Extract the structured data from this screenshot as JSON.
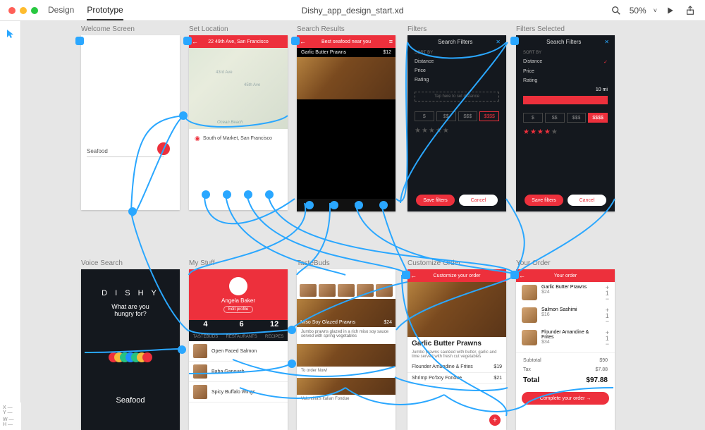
{
  "header": {
    "design_tab": "Design",
    "prototype_tab": "Prototype",
    "filename": "Dishy_app_design_start.xd",
    "zoom": "50%"
  },
  "footer": {
    "x_label": "X",
    "y_label": "Y",
    "w_label": "W",
    "h_label": "H"
  },
  "artboards": {
    "welcome": {
      "label": "Welcome Screen",
      "search_text": "Seafood"
    },
    "set_location": {
      "label": "Set Location",
      "address": "22 49th Ave, San Francisco",
      "marker_text": "South of Market, San Francisco",
      "ocean": "Ocean Beach",
      "ave_a": "43rd Ave",
      "ave_b": "45th Ave"
    },
    "search_results": {
      "label": "Search Results",
      "header_text": "Best seafood near you",
      "item_name": "Garlic Butter Prawns",
      "item_price": "$12"
    },
    "filters": {
      "label": "Filters",
      "title": "Search Filters",
      "sort_by": "SORT BY",
      "distance": "Distance",
      "price": "Price",
      "rating": "Rating",
      "tap_hint": "Tap here to set distance",
      "p1": "$",
      "p2": "$$",
      "p3": "$$$",
      "p4": "$$$$",
      "save": "Save filters",
      "cancel": "Cancel"
    },
    "filters_selected": {
      "label": "Filters Selected",
      "title": "Search Filters",
      "distance_val": "10 mi",
      "save": "Save filters",
      "cancel": "Cancel"
    },
    "voice_search": {
      "label": "Voice Search",
      "brand": "D I S H Y",
      "prompt_a": "What are you",
      "prompt_b": "hungry for?",
      "result": "Seafood"
    },
    "my_stuff": {
      "label": "My Stuff",
      "name": "Angela Baker",
      "edit": "Edit profile",
      "n1": "4",
      "l1": "TASTEBUDS",
      "n2": "6",
      "l2": "RESTAURANTS",
      "n3": "12",
      "l3": "RECIPES",
      "r1": "Open Faced Salmon",
      "r2": "Baba Ganoush",
      "r3": "Spicy Buffalo Wings"
    },
    "tastebuds": {
      "label": "TasteBuds",
      "dish_name": "Miso Soy Glazed Prawns",
      "dish_price": "$24",
      "caption_a": "Jumbo prawns glazed in a rich miso soy sauce served with spring vegetables",
      "caption_b": "To order Now!",
      "caption_c": "Valentina's Italian Fondue"
    },
    "customize": {
      "label": "Customize Order",
      "header_text": "Customize your order",
      "dish_name": "Garlic Butter Prawns",
      "desc": "Jumbo prawns sautéed with butter, garlic and lime served with fresh cut vegetables",
      "opt1": "Flounder Amandine & Frites",
      "opt1_price": "$19",
      "opt2": "Shrimp Po'boy Fondue",
      "opt2_price": "$21"
    },
    "your_order": {
      "label": "Your Order",
      "header_text": "Your order",
      "i1_name": "Garlic Butter Prawns",
      "i1_price": "$24",
      "i2_name": "Salmon Sashimi",
      "i2_price": "$16",
      "i3_name": "Flounder Amandine & Frites",
      "i3_price": "$34",
      "subtotal_l": "Subtotal",
      "subtotal_v": "$90",
      "tax_l": "Tax",
      "tax_v": "$7.88",
      "total_l": "Total",
      "total_v": "$97.88",
      "complete": "Complete your order   →"
    }
  }
}
